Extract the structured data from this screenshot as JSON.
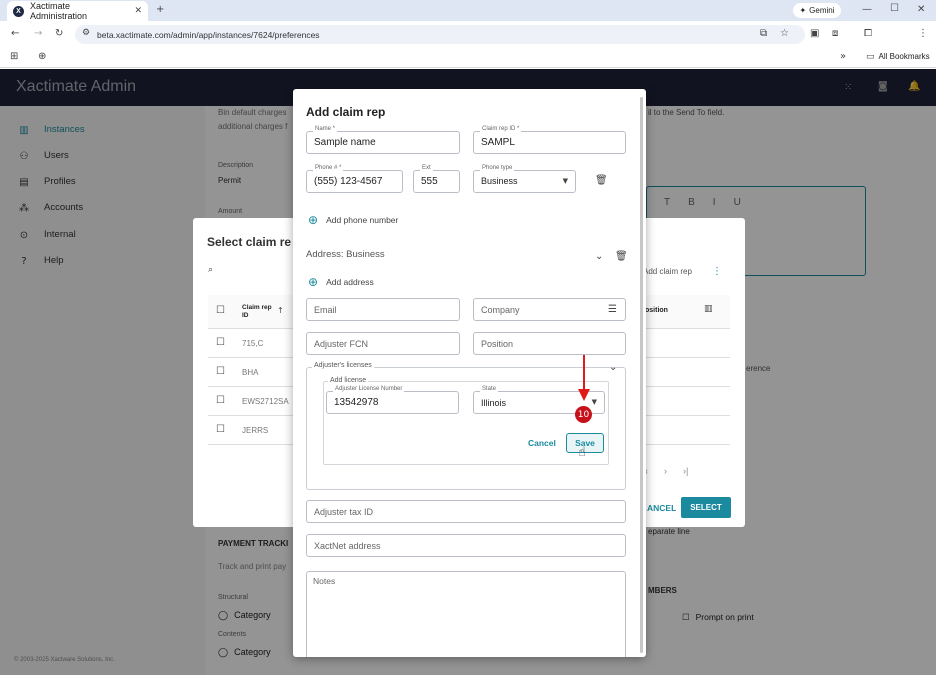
{
  "browser": {
    "tab_title": "Xactimate Administration",
    "url": "beta.xactimate.com/admin/app/instances/7624/preferences",
    "gemini_label": "Gemini",
    "bookmarks_label": "All Bookmarks"
  },
  "app": {
    "title": "Xactimate Admin",
    "nav": [
      "Instances",
      "Users",
      "Profiles",
      "Accounts",
      "Internal",
      "Help"
    ],
    "footer": "© 2003-2025 Xactware Solutions, Inc."
  },
  "background_page": {
    "texts": [
      "Bin default charges",
      "additional charges f",
      "Description",
      "Permit",
      "Amount",
      "PAYMENT TRACKI",
      "Track and print pay",
      "Structural",
      "Category",
      "Contents",
      "Category",
      "il to the Send To field.",
      "erence",
      "eparate line",
      "MBERS",
      "Prompt on print"
    ]
  },
  "select_dialog": {
    "title": "Select claim re",
    "add_claim_rep": "Add claim rep",
    "col_claim_rep_id": "Claim rep ID",
    "col_position": "osition",
    "rows": [
      "715,C",
      "BHA",
      "EWS2712SA",
      "JERRS"
    ],
    "cancel": "ANCEL",
    "select": "SELECT"
  },
  "dialog": {
    "title": "Add claim rep",
    "name_label": "Name *",
    "name_value": "Sample name",
    "claim_rep_id_label": "Claim rep ID *",
    "claim_rep_id_value": "SAMPL",
    "phone_label": "Phone # *",
    "phone_value": "(555) 123-4567",
    "ext_label": "Ext",
    "ext_value": "555",
    "phone_type_label": "Phone type",
    "phone_type_value": "Business",
    "add_phone": "Add phone number",
    "address_title": "Address: Business",
    "add_address": "Add address",
    "email_ph": "Email",
    "company_ph": "Company",
    "adjuster_fcn_ph": "Adjuster FCN",
    "position_ph": "Position",
    "licenses_title": "Adjuster's licenses",
    "add_license_title": "Add license",
    "license_number_label": "Adjuster License Number",
    "license_number_value": "13542978",
    "state_label": "State",
    "state_value": "Illinois",
    "cancel": "Cancel",
    "save": "Save",
    "tax_id_ph": "Adjuster tax ID",
    "xactnet_ph": "XactNet address",
    "notes_ph": "Notes"
  },
  "annotation": {
    "step_number": "10",
    "color": "#e0191b"
  }
}
